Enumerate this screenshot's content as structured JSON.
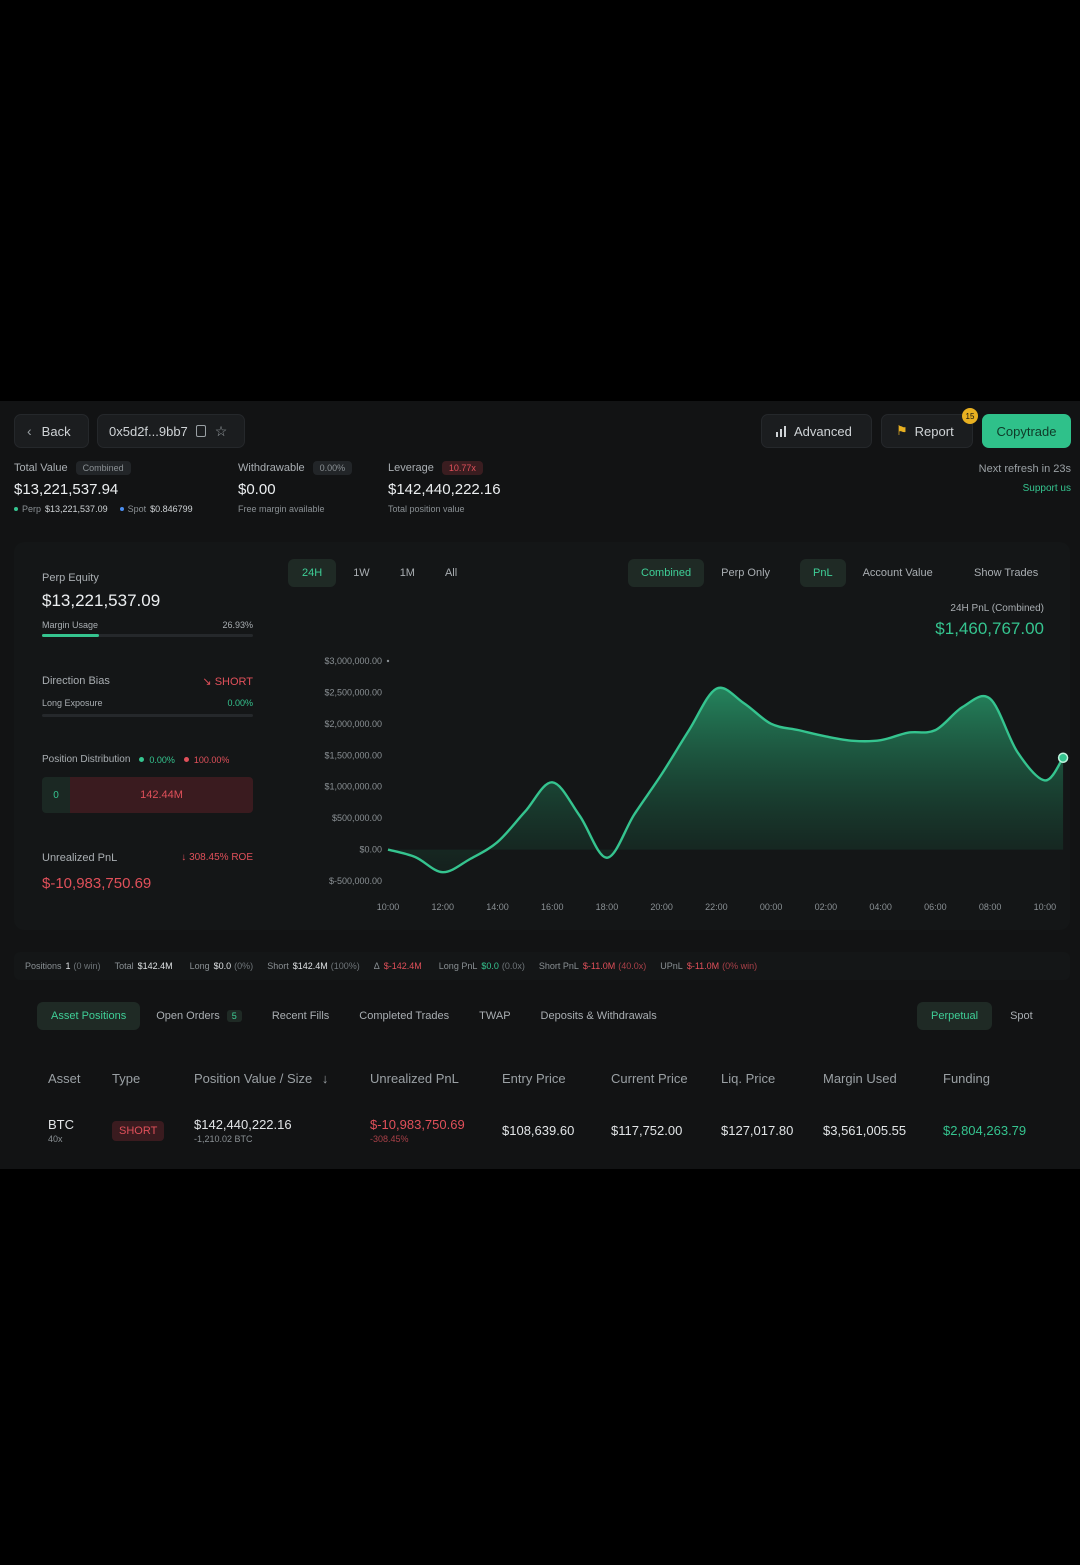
{
  "header": {
    "back_label": "Back",
    "address": "0x5d2f...9bb7",
    "advanced_label": "Advanced",
    "report_label": "Report",
    "report_badge": "15",
    "copytrade_label": "Copytrade",
    "next_refresh": "Next refresh in 23s",
    "support": "Support us"
  },
  "stats": {
    "total_value": {
      "label": "Total Value",
      "tag": "Combined",
      "value": "$13,221,537.94",
      "perp_label": "Perp",
      "perp_value": "$13,221,537.09",
      "spot_label": "Spot",
      "spot_value": "$0.846799"
    },
    "withdrawable": {
      "label": "Withdrawable",
      "tag": "0.00%",
      "value": "$0.00",
      "sub": "Free margin available"
    },
    "leverage": {
      "label": "Leverage",
      "tag": "10.77x",
      "value": "$142,440,222.16",
      "sub": "Total position value"
    }
  },
  "left_panel": {
    "perp_equity_label": "Perp Equity",
    "perp_equity_value": "$13,221,537.09",
    "margin_usage_label": "Margin Usage",
    "margin_usage_value": "26.93%",
    "margin_usage_fraction": 0.2693,
    "direction_bias_label": "Direction Bias",
    "direction_bias_value": "SHORT",
    "long_exposure_label": "Long Exposure",
    "long_exposure_value": "0.00%",
    "position_distribution_label": "Position Distribution",
    "dist_long": "0.00%",
    "dist_short": "100.00%",
    "dist_bar_long": "0",
    "dist_bar_short": "142.44M",
    "unrealized_pnl_label": "Unrealized PnL",
    "roe": "308.45% ROE",
    "unrealized_pnl_value": "$-10,983,750.69"
  },
  "chart_controls": {
    "ranges": [
      "24H",
      "1W",
      "1M",
      "All"
    ],
    "active_range": "24H",
    "modes": [
      "Combined",
      "Perp Only"
    ],
    "active_mode": "Combined",
    "metrics": [
      "PnL",
      "Account Value"
    ],
    "active_metric": "PnL",
    "show_trades": "Show Trades",
    "pnl_label": "24H PnL (Combined)",
    "pnl_value": "$1,460,767.00"
  },
  "chart_data": {
    "type": "area",
    "title": "",
    "xlabel": "",
    "ylabel": "",
    "y_ticks": [
      "$3,000,000.00",
      "$2,500,000.00",
      "$2,000,000.00",
      "$1,500,000.00",
      "$1,000,000.00",
      "$500,000.00",
      "$0.00",
      "$-500,000.00"
    ],
    "x_ticks": [
      "10:00",
      "12:00",
      "14:00",
      "16:00",
      "18:00",
      "20:00",
      "22:00",
      "00:00",
      "02:00",
      "04:00",
      "06:00",
      "08:00",
      "10:00"
    ],
    "ylim": [
      -500000,
      3000000
    ],
    "grid": false,
    "series": [
      {
        "color": "#35c48f",
        "points": [
          {
            "x": "10:00",
            "y": 0
          },
          {
            "x": "11:00",
            "y": -120000
          },
          {
            "x": "12:00",
            "y": -360000
          },
          {
            "x": "13:00",
            "y": -150000
          },
          {
            "x": "14:00",
            "y": 120000
          },
          {
            "x": "15:00",
            "y": 600000
          },
          {
            "x": "16:00",
            "y": 1070000
          },
          {
            "x": "17:00",
            "y": 540000
          },
          {
            "x": "18:00",
            "y": -130000
          },
          {
            "x": "19:00",
            "y": 560000
          },
          {
            "x": "20:00",
            "y": 1200000
          },
          {
            "x": "21:00",
            "y": 1900000
          },
          {
            "x": "22:00",
            "y": 2560000
          },
          {
            "x": "23:00",
            "y": 2330000
          },
          {
            "x": "00:00",
            "y": 2000000
          },
          {
            "x": "01:00",
            "y": 1900000
          },
          {
            "x": "02:00",
            "y": 1800000
          },
          {
            "x": "03:00",
            "y": 1730000
          },
          {
            "x": "04:00",
            "y": 1740000
          },
          {
            "x": "05:00",
            "y": 1860000
          },
          {
            "x": "06:00",
            "y": 1900000
          },
          {
            "x": "07:00",
            "y": 2270000
          },
          {
            "x": "08:00",
            "y": 2400000
          },
          {
            "x": "09:00",
            "y": 1550000
          },
          {
            "x": "10:00",
            "y": 1100000
          },
          {
            "x": "10:40",
            "y": 1460767
          }
        ]
      }
    ]
  },
  "summary_bar": [
    {
      "label": "Positions",
      "value": "1",
      "note": "(0 win)"
    },
    {
      "label": "Total",
      "value": "$142.4M",
      "note": ""
    },
    {
      "label": "Long",
      "value": "$0.0",
      "note": "(0%)"
    },
    {
      "label": "Short",
      "value": "$142.4M",
      "note": "(100%)"
    },
    {
      "label": "Δ",
      "value": "$-142.4M",
      "note": ""
    },
    {
      "label": "Long PnL",
      "value": "$0.0",
      "note": "(0.0x)"
    },
    {
      "label": "Short PnL",
      "value": "$-11.0M",
      "note": "(40.0x)"
    },
    {
      "label": "UPnL",
      "value": "$-11.0M",
      "note": "(0% win)"
    }
  ],
  "tabs": {
    "items": [
      "Asset Positions",
      "Open Orders",
      "Recent Fills",
      "Completed Trades",
      "TWAP",
      "Deposits & Withdrawals"
    ],
    "open_orders_badge": "5",
    "active": "Asset Positions",
    "right": [
      "Perpetual",
      "Spot"
    ],
    "active_right": "Perpetual"
  },
  "table": {
    "headers": [
      "Asset",
      "Type",
      "Position Value / Size",
      "Unrealized PnL",
      "Entry Price",
      "Current Price",
      "Liq. Price",
      "Margin Used",
      "Funding"
    ],
    "rows": [
      {
        "asset": "BTC",
        "leverage": "40x",
        "type": "SHORT",
        "position_value": "$142,440,222.16",
        "size": "-1,210.02 BTC",
        "upnl": "$-10,983,750.69",
        "upnl_pct": "-308.45%",
        "entry": "$108,639.60",
        "current": "$117,752.00",
        "liq": "$127,017.80",
        "margin": "$3,561,005.55",
        "funding": "$2,804,263.79"
      }
    ]
  },
  "colors": {
    "accent": "#35c48f",
    "danger": "#e0505a",
    "background": "#121314"
  }
}
